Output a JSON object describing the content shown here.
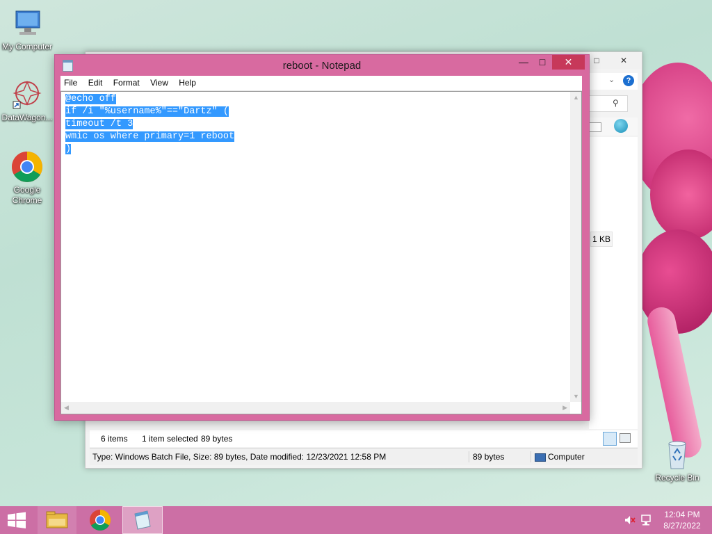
{
  "desktop": {
    "icons": [
      {
        "label": "My Computer",
        "icon": "computer-icon"
      },
      {
        "label": "DataWagon...",
        "icon": "datawagon-icon"
      },
      {
        "label": "Google Chrome",
        "icon": "chrome-icon"
      },
      {
        "label": "Recycle Bin",
        "icon": "recycle-bin-icon"
      }
    ]
  },
  "explorer": {
    "size_badge": "1 KB",
    "info": {
      "items": "6 items",
      "selected": "1 item selected",
      "selected_size": "89 bytes"
    },
    "status": {
      "details": "Type: Windows Batch File, Size: 89 bytes, Date modified: 12/23/2021 12:58 PM",
      "size": "89 bytes",
      "location": "Computer"
    }
  },
  "notepad": {
    "title": "reboot - Notepad",
    "menu": [
      "File",
      "Edit",
      "Format",
      "View",
      "Help"
    ],
    "lines": [
      "@echo off",
      "if /i \"%username%\"==\"Dartz\" (",
      "timeout /t 3",
      "wmic os where primary=1 reboot",
      ")"
    ],
    "selection": "all"
  },
  "taskbar": {
    "apps": [
      "windows-start-icon",
      "file-explorer-icon",
      "chrome-icon",
      "notepad-icon"
    ],
    "clock": {
      "time": "12:04 PM",
      "date": "8/27/2022"
    },
    "colors": {
      "taskbar": "#cc6fa5",
      "notepad_frame": "#d86aa0",
      "selection": "#3399ff"
    }
  }
}
